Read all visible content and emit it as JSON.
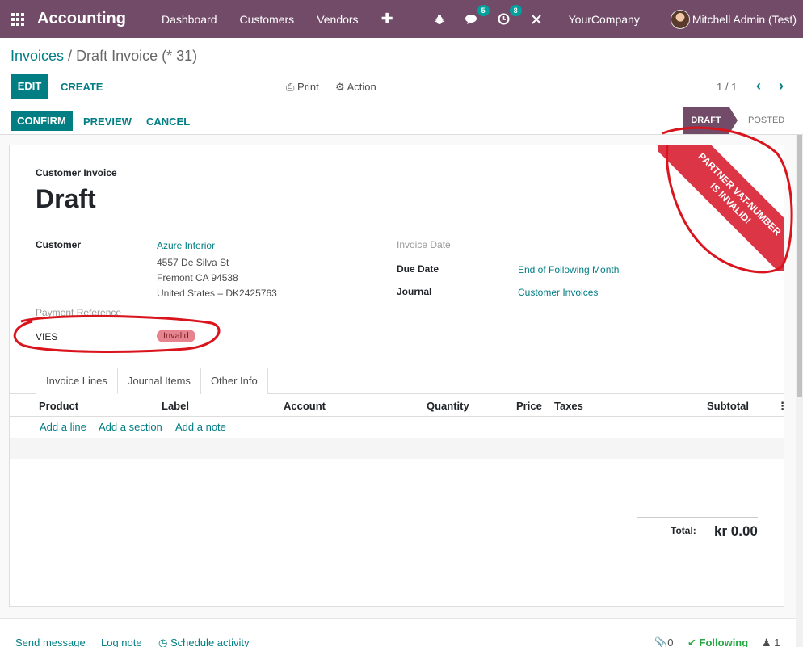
{
  "navbar": {
    "brand": "Accounting",
    "menu": [
      "Dashboard",
      "Customers",
      "Vendors"
    ],
    "plus": "✚",
    "messages_badge": "5",
    "activities_badge": "8",
    "company": "YourCompany",
    "user": "Mitchell Admin (Test)"
  },
  "breadcrumb": {
    "parent": "Invoices",
    "separator": " / ",
    "current": "Draft Invoice (* 31)"
  },
  "control": {
    "edit": "EDIT",
    "create": "CREATE",
    "print": "Print",
    "action": "Action",
    "pager": "1 / 1"
  },
  "statusbar": {
    "confirm": "CONFIRM",
    "preview": "PREVIEW",
    "cancel": "CANCEL",
    "stage_draft": "DRAFT",
    "stage_posted": "POSTED"
  },
  "form": {
    "doc_type": "Customer Invoice",
    "title": "Draft",
    "customer_label": "Customer",
    "customer_name": "Azure Interior",
    "customer_address_1": "4557 De Silva St",
    "customer_address_2": "Fremont CA 94538",
    "customer_address_3": "United States – DK2425763",
    "payment_ref_label": "Payment Reference",
    "vies_label": "VIES",
    "vies_value": "Invalid",
    "invoice_date_label": "Invoice Date",
    "due_date_label": "Due Date",
    "due_date_value": "End of Following Month",
    "journal_label": "Journal",
    "journal_value": "Customer Invoices",
    "ribbon_line1": "Partner VAT-number",
    "ribbon_line2": "is invalid!"
  },
  "tabs": [
    "Invoice Lines",
    "Journal Items",
    "Other Info"
  ],
  "table": {
    "columns": [
      "Product",
      "Label",
      "Account",
      "Quantity",
      "Price",
      "Taxes",
      "Subtotal"
    ],
    "add_line": "Add a line",
    "add_section": "Add a section",
    "add_note": "Add a note"
  },
  "totals": {
    "label": "Total:",
    "value": "kr 0.00"
  },
  "chatter": {
    "send_message": "Send message",
    "log_note": "Log note",
    "schedule_activity": "Schedule activity",
    "attachments": "0",
    "following": "Following",
    "followers": "1"
  },
  "colors": {
    "navbar": "#714b67",
    "primary": "#017e84",
    "ribbon": "#dc3545",
    "annotation": "#d9141c"
  }
}
